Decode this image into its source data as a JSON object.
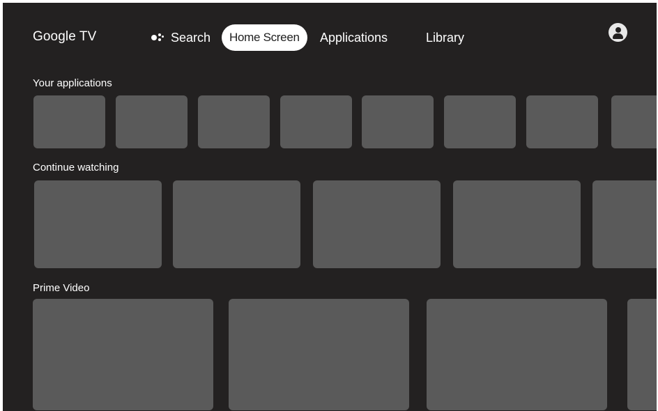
{
  "app": {
    "title": "Google TV"
  },
  "nav": {
    "search_label": "Search",
    "search_icon": "assistant-icon",
    "home_label": "Home Screen",
    "apps_label": "Applications",
    "library_label": "Library",
    "profile_icon": "account-icon"
  },
  "sections": {
    "your_apps": {
      "title": "Your applications",
      "tile_count": 8
    },
    "continue_watching": {
      "title": "Continue watching",
      "tile_count": 5
    },
    "prime_video": {
      "title": "Prime Video",
      "tile_count": 4
    }
  },
  "colors": {
    "background": "#232121",
    "tile": "#5a5a5a",
    "selected_tab_bg": "#ffffff",
    "text": "#ffffff"
  }
}
